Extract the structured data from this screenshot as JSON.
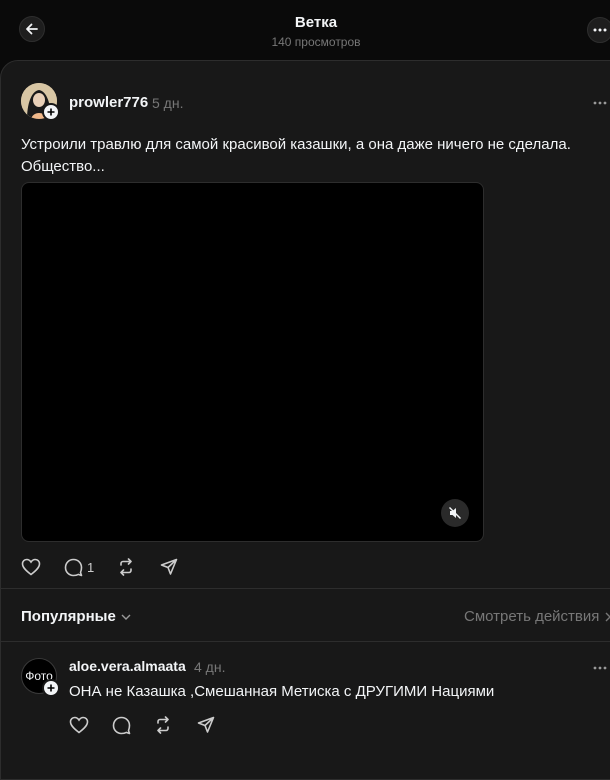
{
  "header": {
    "title": "Ветка",
    "views": "140 просмотров"
  },
  "post": {
    "username": "prowler776",
    "time": "5 дн.",
    "text": "Устроили травлю для самой красивой казашки, а она даже ничего не сделала. Общество...",
    "replies_count": "1"
  },
  "replies_section": {
    "sort_label": "Популярные",
    "view_activity": "Смотреть действия"
  },
  "reply": {
    "username": "aloe.vera.almaata",
    "time": "4 дн.",
    "avatar_text": "Фото",
    "text": "ОНА не Казашка ,Смешанная Метиска с ДРУГИМИ Нациями"
  },
  "colors": {
    "background": "#0a0a0a",
    "panel": "#181818",
    "text": "#f3f5f7",
    "muted": "#777777"
  },
  "icons": [
    "back-arrow-icon",
    "more-icon",
    "plus-icon",
    "mute-icon",
    "heart-icon",
    "comment-icon",
    "repost-icon",
    "share-icon",
    "chevron-down-icon",
    "chevron-right-icon"
  ]
}
